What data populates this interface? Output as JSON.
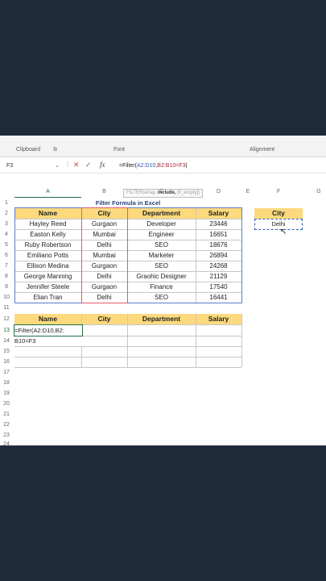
{
  "ribbon": {
    "groups": [
      "Clipboard",
      "Font",
      "Alignment"
    ]
  },
  "formula_bar": {
    "name_box": "F3",
    "formula_prefix": "=Filter(",
    "formula_ref1": "A2:D10",
    "formula_mid": ",",
    "formula_ref2": "B2:B10=F3",
    "tooltip_fn": "FILTER(array,",
    "tooltip_bold": "include,",
    "tooltip_rest": "[if_empty])"
  },
  "columns": [
    "A",
    "B",
    "C",
    "D",
    "E",
    "F",
    "G"
  ],
  "row_numbers": [
    "1",
    "2",
    "3",
    "4",
    "5",
    "6",
    "7",
    "8",
    "9",
    "10",
    "11",
    "12",
    "13",
    "14",
    "15",
    "16",
    "17",
    "18",
    "19",
    "20",
    "21",
    "22",
    "23",
    "24"
  ],
  "table": {
    "title": "Filter Formula in Excel",
    "headers": [
      "Name",
      "City",
      "Department",
      "Salary"
    ],
    "rows": [
      [
        "Hayley Reed",
        "Gurgaon",
        "Developer",
        "23446"
      ],
      [
        "Easton Kelly",
        "Mumbai",
        "Engineer",
        "16651"
      ],
      [
        "Ruby Robertson",
        "Delhi",
        "SEO",
        "18676"
      ],
      [
        "Emiliano Potts",
        "Mumbai",
        "Marketer",
        "26894"
      ],
      [
        "Ellison Medina",
        "Gurgaon",
        "SEO",
        "24268"
      ],
      [
        "George Manning",
        "Delhi",
        "Graohic Designer",
        "21129"
      ],
      [
        "Jennifer Steele",
        "Gurgaon",
        "Finance",
        "17540"
      ],
      [
        "Elian Tran",
        "Delhi",
        "SEO",
        "16441"
      ]
    ]
  },
  "criteria": {
    "header": "City",
    "value": "Delhi"
  },
  "result_table": {
    "headers": [
      "Name",
      "City",
      "Department",
      "Salary"
    ],
    "edit_line1": "=Filter(A2:D10,B2:",
    "edit_line2": "B10=F3"
  }
}
